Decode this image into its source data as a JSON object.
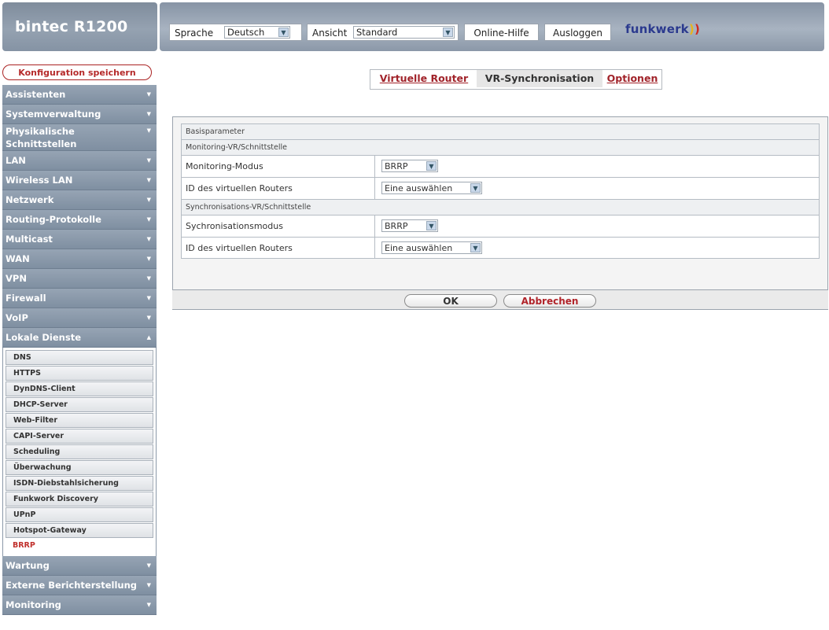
{
  "header": {
    "product": "bintec R1200",
    "language_label": "Sprache",
    "language_value": "Deutsch",
    "view_label": "Ansicht",
    "view_value": "Standard",
    "help_label": "Online-Hilfe",
    "logout_label": "Ausloggen",
    "brand": "funkwerk"
  },
  "sidebar": {
    "save_label": "Konfiguration speichern",
    "items_top": [
      {
        "label": "Assistenten"
      },
      {
        "label": "Systemverwaltung"
      },
      {
        "label": "Physikalische Schnittstellen"
      },
      {
        "label": "LAN"
      },
      {
        "label": "Wireless LAN"
      },
      {
        "label": "Netzwerk"
      },
      {
        "label": "Routing-Protokolle"
      },
      {
        "label": "Multicast"
      },
      {
        "label": "WAN"
      },
      {
        "label": "VPN"
      },
      {
        "label": "Firewall"
      },
      {
        "label": "VoIP"
      },
      {
        "label": "Lokale Dienste"
      }
    ],
    "sub_items": [
      {
        "label": "DNS"
      },
      {
        "label": "HTTPS"
      },
      {
        "label": "DynDNS-Client"
      },
      {
        "label": "DHCP-Server"
      },
      {
        "label": "Web-Filter"
      },
      {
        "label": "CAPI-Server"
      },
      {
        "label": "Scheduling"
      },
      {
        "label": "Überwachung"
      },
      {
        "label": "ISDN-Diebstahlsicherung"
      },
      {
        "label": "Funkwork Discovery"
      },
      {
        "label": "UPnP"
      },
      {
        "label": "Hotspot-Gateway"
      },
      {
        "label": "BRRP"
      }
    ],
    "items_bottom": [
      {
        "label": "Wartung"
      },
      {
        "label": "Externe Berichterstellung"
      },
      {
        "label": "Monitoring"
      }
    ]
  },
  "tabs": [
    {
      "label": "Virtuelle Router"
    },
    {
      "label": "VR-Synchronisation"
    },
    {
      "label": "Optionen"
    }
  ],
  "form": {
    "section_basic": "Basisparameter",
    "section_monitoring": "Monitoring-VR/Schnittstelle",
    "monitoring_mode_label": "Monitoring-Modus",
    "monitoring_mode_value": "BRRP",
    "monitoring_router_label": "ID des virtuellen Routers",
    "monitoring_router_value": "Eine auswählen",
    "section_sync": "Synchronisations-VR/Schnittstelle",
    "sync_mode_label": "Sychronisationsmodus",
    "sync_mode_value": "BRRP",
    "sync_router_label": "ID des virtuellen Routers",
    "sync_router_value": "Eine auswählen"
  },
  "buttons": {
    "ok": "OK",
    "cancel": "Abbrechen"
  },
  "colors": {
    "accent": "#a1232a",
    "nav": "#8b98a8"
  }
}
